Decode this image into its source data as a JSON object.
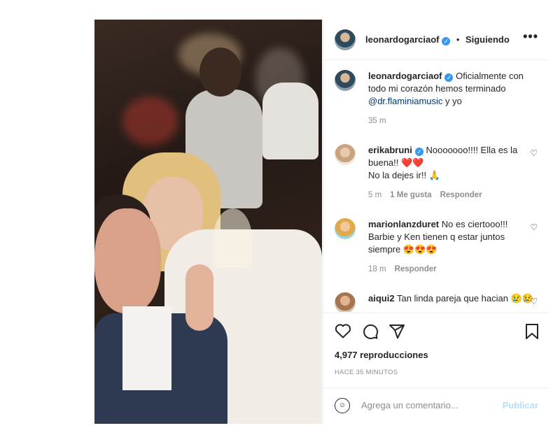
{
  "post": {
    "username": "leonardogarciaof",
    "follow_state": "Siguiendo",
    "more_icon": "more-dots-icon"
  },
  "caption": {
    "username": "leonardogarciaof",
    "text_before": "Oficialmente con todo mi corazón hemos terminado ",
    "mention": "@dr.flaminiamusic",
    "text_after": " y yo",
    "time": "35 m"
  },
  "comments": [
    {
      "username": "erikabruni",
      "text": "Nooooooo!!!! Ella es la buena!! ❤️❤️",
      "text2": "No la dejes ir!! 🙏",
      "time": "5 m",
      "likes": "1 Me gusta",
      "reply": "Responder"
    },
    {
      "username": "marionlanzduret",
      "text": "No es ciertooo!!! Barbie y Ken tienen q estar juntos siempre 😍😍😍",
      "time": "18 m",
      "reply": "Responder"
    },
    {
      "username": "aiqui2",
      "text": "Tan linda pareja que hacian 😢😢"
    }
  ],
  "actions": {
    "like_icon": "heart-icon",
    "comment_icon": "comment-icon",
    "share_icon": "send-icon",
    "save_icon": "bookmark-icon"
  },
  "stats": {
    "views": "4,977 reproducciones",
    "posted": "HACE 35 MINUTOS"
  },
  "add_comment": {
    "placeholder": "Agrega un comentario...",
    "publish": "Publicar"
  },
  "colors": {
    "link": "#00376b",
    "verified": "#3897f0",
    "muted": "#8e8e8e",
    "publish_disabled": "#b2dffc"
  }
}
